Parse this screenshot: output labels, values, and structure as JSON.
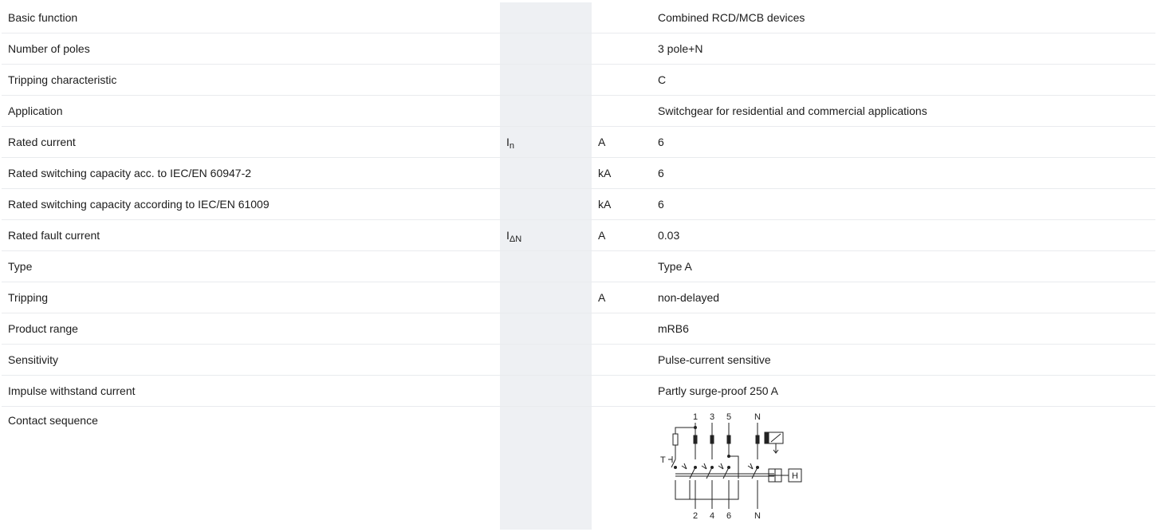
{
  "rows": [
    {
      "label": "Basic function",
      "symbol": "",
      "symbol_sub": "",
      "unit": "",
      "value": "Combined RCD/MCB devices"
    },
    {
      "label": "Number of poles",
      "symbol": "",
      "symbol_sub": "",
      "unit": "",
      "value": "3 pole+N"
    },
    {
      "label": "Tripping characteristic",
      "symbol": "",
      "symbol_sub": "",
      "unit": "",
      "value": "C"
    },
    {
      "label": "Application",
      "symbol": "",
      "symbol_sub": "",
      "unit": "",
      "value": "Switchgear for residential and commercial applications"
    },
    {
      "label": "Rated current",
      "symbol": "I",
      "symbol_sub": "n",
      "unit": "A",
      "value": "6"
    },
    {
      "label": "Rated switching capacity acc. to IEC/EN 60947-2",
      "symbol": "",
      "symbol_sub": "",
      "unit": "kA",
      "value": "6"
    },
    {
      "label": "Rated switching capacity according to IEC/EN 61009",
      "symbol": "",
      "symbol_sub": "",
      "unit": "kA",
      "value": "6"
    },
    {
      "label": "Rated fault current",
      "symbol": "I",
      "symbol_sub": "ΔN",
      "unit": "A",
      "value": "0.03"
    },
    {
      "label": "Type",
      "symbol": "",
      "symbol_sub": "",
      "unit": "",
      "value": "Type A"
    },
    {
      "label": "Tripping",
      "symbol": "",
      "symbol_sub": "",
      "unit": "A",
      "value": "non-delayed"
    },
    {
      "label": "Product range",
      "symbol": "",
      "symbol_sub": "",
      "unit": "",
      "value": "mRB6"
    },
    {
      "label": "Sensitivity",
      "symbol": "",
      "symbol_sub": "",
      "unit": "",
      "value": "Pulse-current sensitive"
    },
    {
      "label": "Impulse withstand current",
      "symbol": "",
      "symbol_sub": "",
      "unit": "",
      "value": "Partly surge-proof 250 A"
    }
  ],
  "contact_sequence": {
    "label": "Contact sequence",
    "top_terminals": [
      "1",
      "3",
      "5",
      "N"
    ],
    "bottom_terminals": [
      "2",
      "4",
      "6",
      "N"
    ],
    "test_button": "T",
    "trip_unit": "H"
  }
}
